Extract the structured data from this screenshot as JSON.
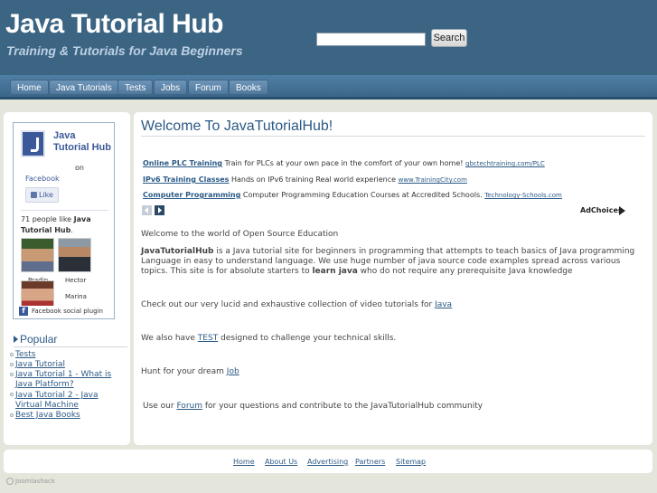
{
  "header": {
    "title": "Java Tutorial Hub",
    "tagline": "Training & Tutorials for Java Beginners",
    "search_placeholder": "",
    "search_button": "Search"
  },
  "nav": [
    "Home",
    "Java Tutorials",
    "Tests",
    "Jobs",
    "Forum",
    "Books"
  ],
  "facebook": {
    "page_name": "Java Tutorial Hub",
    "on": "on",
    "platform": "Facebook",
    "like_button": "Like",
    "count_prefix": "71 people like ",
    "count_page": "Java Tutorial Hub",
    "count_suffix": ".",
    "faces": [
      "Pradip",
      "Hector",
      "Marina"
    ],
    "plugin_label": "Facebook social plugin"
  },
  "popular": {
    "heading": "Popular",
    "items": [
      "Tests",
      "Java Tutorial",
      "Java Tutorial 1 - What is Java Platform?",
      "Java Tutorial 2 - Java Virtual Machine",
      "Best Java Books"
    ]
  },
  "main": {
    "title": "Welcome To JavaTutorialHub!",
    "ads": [
      {
        "title": "Online PLC Training",
        "text": "Train for PLCs at your own pace in the comfort of your own home!",
        "url": "gbctechtraining.com/PLC"
      },
      {
        "title": "IPv6 Training Classes",
        "text": "Hands on IPv6 training Real world experience",
        "url": "www.TrainingCity.com"
      },
      {
        "title": "Computer Programming",
        "text": "Computer Programming Education Courses at Accredited Schools.",
        "url": "Technology-Schools.com"
      }
    ],
    "adchoices": "AdChoices",
    "intro": "Welcome to the world of Open Source Education",
    "about_bold": "JavaTutorialHub",
    "about_text1": " is a Java tutorial site for beginners in programming that attempts to teach basics of Java programming Language in easy to understand language.  We use huge number of java source code examples spread across various topics. This site is for absolute starters to ",
    "about_bold2": "learn java",
    "about_text2": " who do not require any prerequisite Java knowledge",
    "video_text": "Check out our very lucid and exhaustive collection of video tutorials for ",
    "video_link": "Java",
    "test_text1": "We also have ",
    "test_link": "TEST",
    "test_text2": " designed to challenge your technical skills.",
    "job_text": "Hunt for your dream ",
    "job_link": "Job",
    "forum_text1": "Use our ",
    "forum_link": "Forum",
    "forum_text2": "  for your questions and contribute to the JavaTutorialHub community"
  },
  "footer": {
    "links": [
      "Home",
      "About Us",
      "Advertising",
      "Partners",
      "Sitemap"
    ],
    "credit": "Joomlashack"
  },
  "colors": {
    "header_bg": "#3c6584",
    "link": "#2c5a86",
    "facebook": "#3b5998"
  }
}
